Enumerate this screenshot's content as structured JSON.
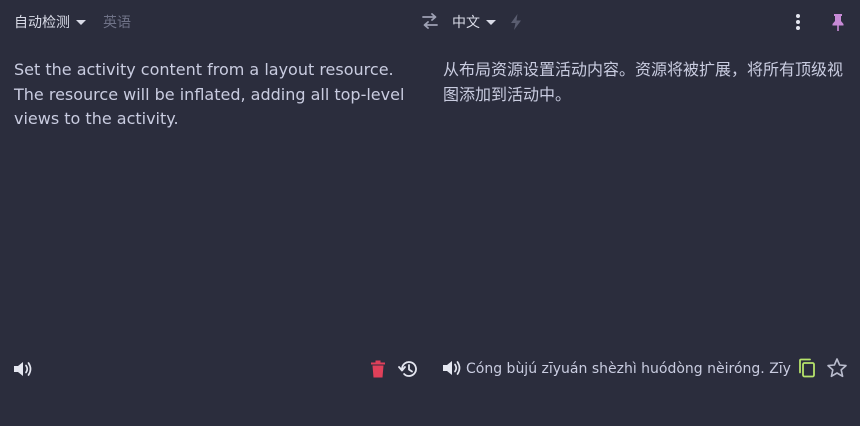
{
  "source": {
    "language": "自动检测",
    "detected_language": "英语",
    "text": "Set the activity content from a layout resource. The resource will be inflated, adding all top-level views to the activity."
  },
  "target": {
    "language": "中文",
    "text": "从布局资源设置活动内容。资源将被扩展，将所有顶级视图添加到活动中。",
    "pinyin": "Cóng bùjú zīyuán shèzhì huódòng nèiróng. Zīyuán jiāng bèi kuòzhǎn"
  },
  "colors": {
    "background": "#2b2d3d",
    "trash": "#e0405a",
    "copy": "#b7e36b",
    "pin": "#c78ad6"
  },
  "icons": {
    "swap": "swap-icon",
    "flash": "flash-icon",
    "more": "more-vertical-icon",
    "pin": "pin-icon",
    "speaker": "speaker-icon",
    "trash": "trash-icon",
    "history": "history-icon",
    "copy": "copy-icon",
    "star": "star-icon"
  }
}
